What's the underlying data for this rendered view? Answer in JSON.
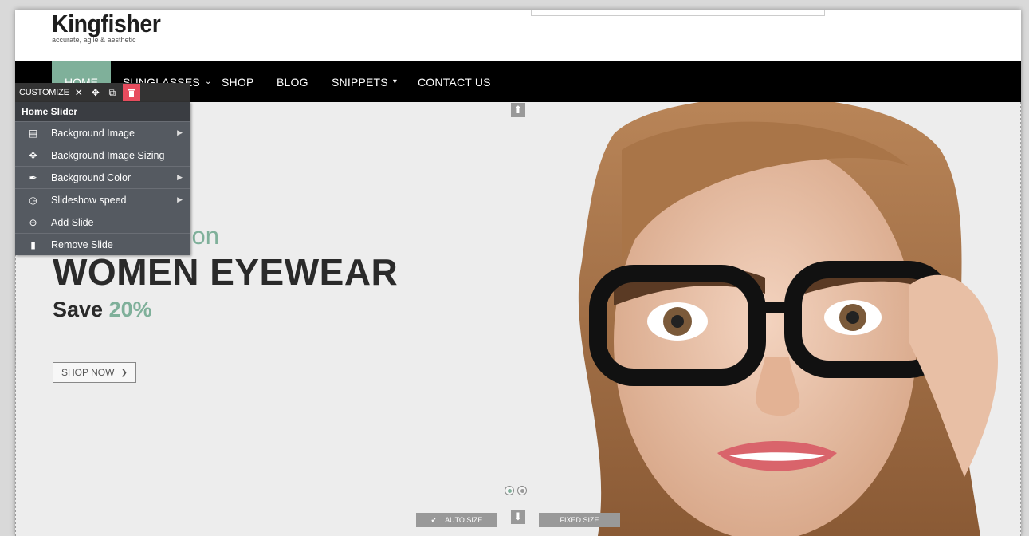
{
  "header": {
    "logo_title": "Kingfisher",
    "logo_tagline": "accurate, agile & aesthetic"
  },
  "nav": {
    "items": [
      {
        "label": "HOME",
        "active": true
      },
      {
        "label": "SUNGLASSES",
        "dropdown": true
      },
      {
        "label": "SHOP"
      },
      {
        "label": "BLOG"
      },
      {
        "label": "SNIPPETS",
        "dropdown": true
      },
      {
        "label": "CONTACT US"
      }
    ]
  },
  "toolbar": {
    "label": "CUSTOMIZE",
    "close_icon": "close-icon",
    "move_icon": "move-icon",
    "clone_icon": "clone-icon",
    "delete_icon": "trash-icon"
  },
  "customize_menu": {
    "title": "Home Slider",
    "items": [
      {
        "label": "Background Image",
        "icon": "image-icon",
        "submenu": true
      },
      {
        "label": "Background Image Sizing",
        "icon": "move-icon",
        "submenu": false
      },
      {
        "label": "Background Color",
        "icon": "eyedropper-icon",
        "submenu": true
      },
      {
        "label": "Slideshow speed",
        "icon": "clock-icon",
        "submenu": true
      },
      {
        "label": "Add Slide",
        "icon": "plus-circle-icon",
        "submenu": false
      },
      {
        "label": "Remove Slide",
        "icon": "trash-icon",
        "submenu": false
      }
    ]
  },
  "hero": {
    "subtitle_visible": "tion",
    "title": "WOMEN EYEWEAR",
    "save_label": "Save",
    "save_percent": "20%",
    "shop_now": "SHOP NOW",
    "auto_size": "AUTO SIZE",
    "fixed_size": "FIXED SIZE"
  },
  "colors": {
    "accent": "#7fb09a",
    "nav_bg": "#000000",
    "delete_red": "#e74c5e",
    "menu_bg": "#555a61"
  }
}
